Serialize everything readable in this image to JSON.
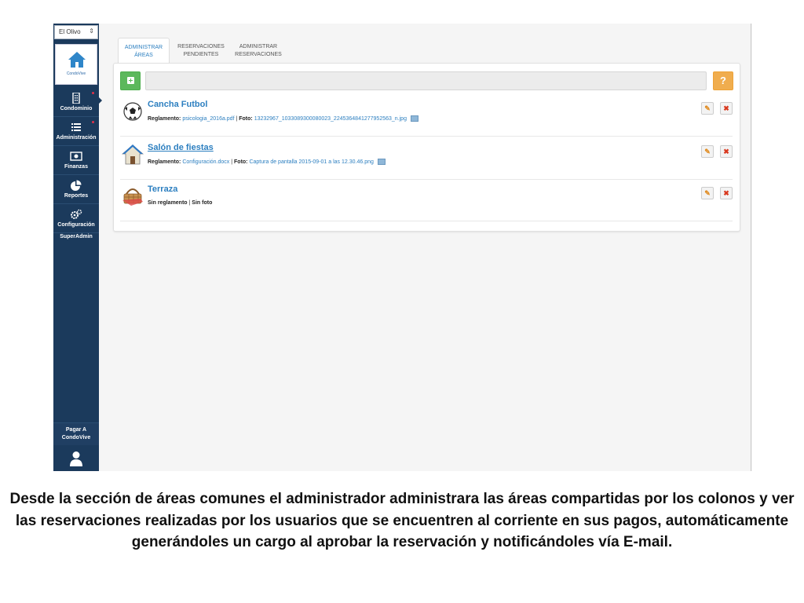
{
  "sidebar": {
    "selector_value": "El Olivo",
    "logo_text": "CondoVive",
    "items": [
      {
        "label": "Condominio",
        "icon": "building-icon"
      },
      {
        "label": "Administración",
        "icon": "list-icon"
      },
      {
        "label": "Finanzas",
        "icon": "money-icon"
      },
      {
        "label": "Reportes",
        "icon": "pie-chart-icon"
      },
      {
        "label": "Configuración",
        "icon": "gears-icon"
      }
    ],
    "superadmin": "SuperAdmin",
    "pagar_line1": "Pagar A",
    "pagar_line2": "CondoVive"
  },
  "tabs": [
    {
      "line1": "ADMINISTRAR",
      "line2": "ÁREAS"
    },
    {
      "line1": "RESERVACIONES",
      "line2": "PENDIENTES"
    },
    {
      "line1": "ADMINISTRAR",
      "line2": "RESERVACIONES"
    }
  ],
  "areas": [
    {
      "title": "Cancha Futbol",
      "reglamento_label": "Reglamento:",
      "reglamento_file": "psicologia_2016a.pdf",
      "sep": " | ",
      "foto_label": "Foto:",
      "foto_file": "13232967_1033089300080023_2245364841277952563_n.jpg",
      "icon": "soccer-ball-icon"
    },
    {
      "title": "Salón de fiestas",
      "reglamento_label": "Reglamento:",
      "reglamento_file": "Configuración.docx",
      "sep": " | ",
      "foto_label": "Foto:",
      "foto_file": "Captura de pantalla 2015-09-01 a las 12.30.46.png",
      "icon": "house-icon"
    },
    {
      "title": "Terraza",
      "no_reglamento": "Sin reglamento",
      "sep": " | ",
      "no_foto": "Sin foto",
      "icon": "picnic-basket-icon"
    }
  ],
  "help_label": "?",
  "caption": "Desde la sección de áreas comunes el administrador administrara las áreas compartidas por los colonos y ver las reservaciones realizadas por los usuarios que se encuentren al corriente en sus pagos, automáticamente generándoles un cargo al aprobar la reservación y notificándoles vía E-mail.",
  "colors": {
    "sidebar": "#1b3a5c",
    "link": "#2c7fc0",
    "add": "#5cb85c",
    "help": "#f0ad4e"
  }
}
